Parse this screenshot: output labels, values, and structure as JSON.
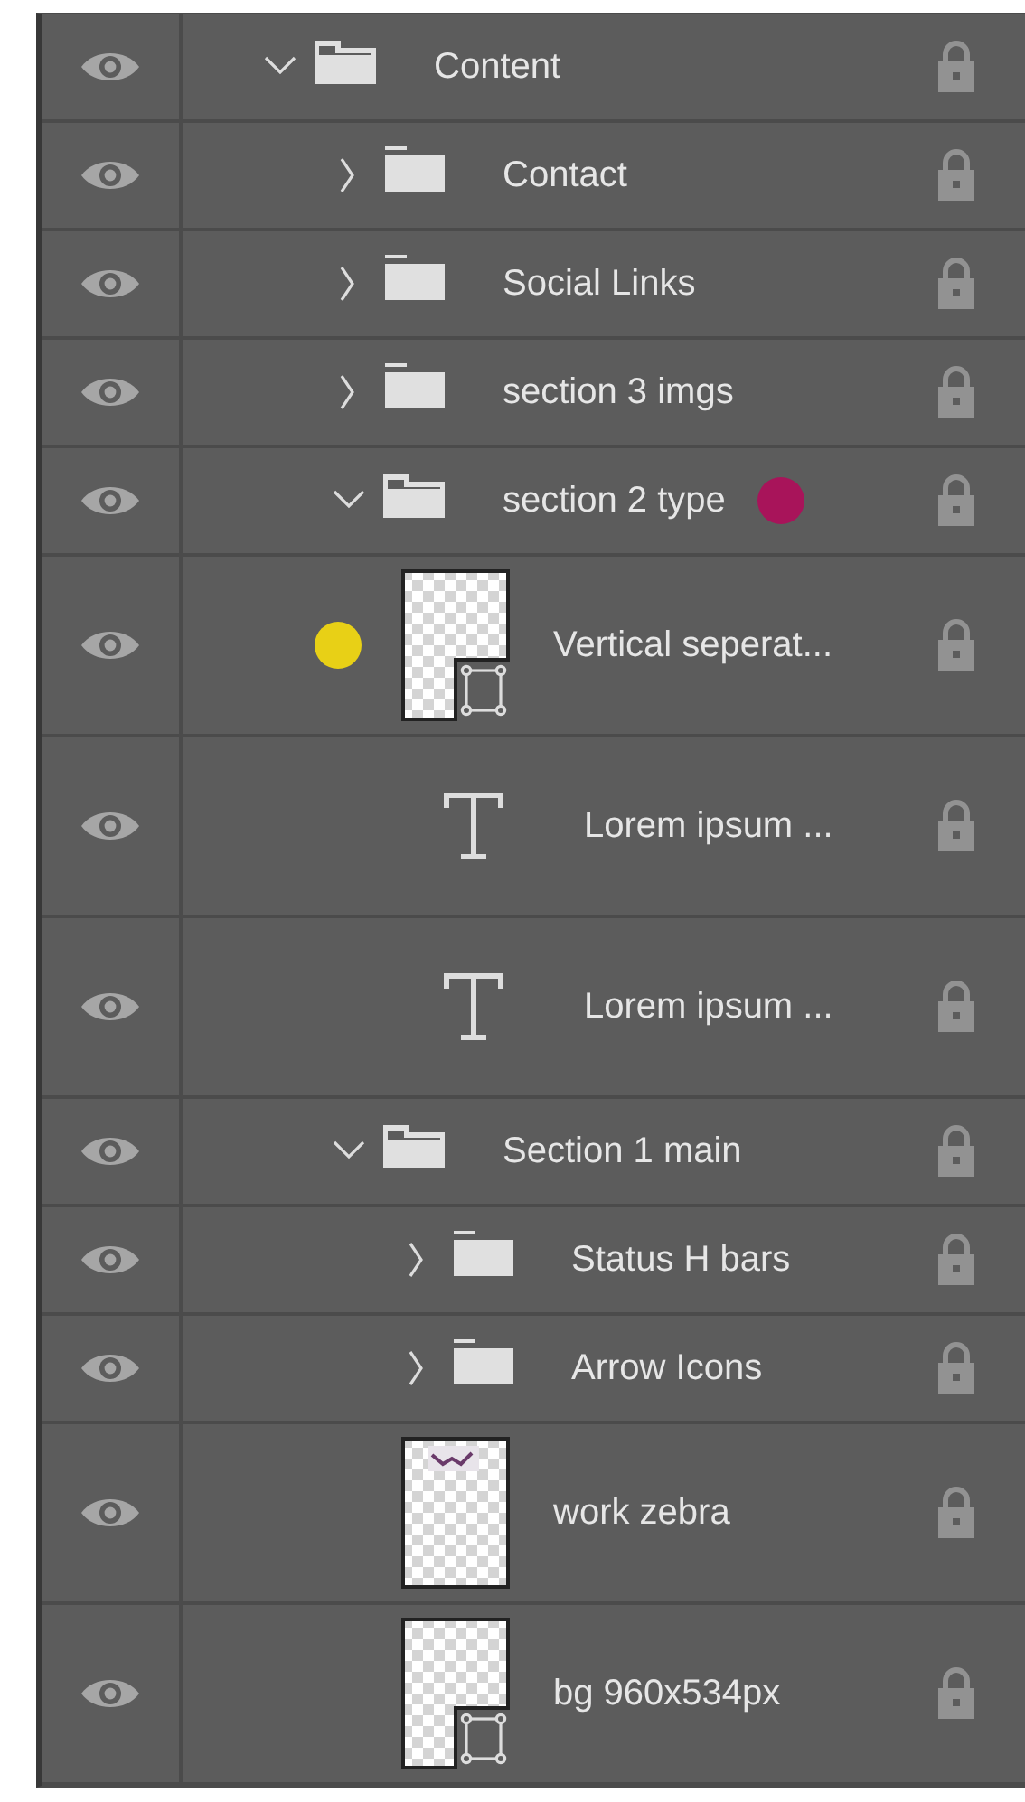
{
  "layers": [
    {
      "kind": "group",
      "name": "Content",
      "visible": true,
      "expanded": true,
      "children": [
        {
          "kind": "group",
          "name": "Contact",
          "visible": true,
          "expanded": false
        },
        {
          "kind": "group",
          "name": "Social Links",
          "visible": true,
          "expanded": false
        },
        {
          "kind": "group",
          "name": "section 3 imgs",
          "visible": true,
          "expanded": false
        },
        {
          "kind": "group",
          "name": "section 2 type",
          "visible": true,
          "expanded": true,
          "color": "#a8145a",
          "children": [
            {
              "kind": "shape",
              "name": "Vertical seperat...",
              "visible": true,
              "color": "#e8d016"
            },
            {
              "kind": "text",
              "name": "Lorem ipsum ...",
              "visible": true
            },
            {
              "kind": "text",
              "name": "Lorem ipsum ...",
              "visible": true
            }
          ]
        },
        {
          "kind": "group",
          "name": "Section 1 main",
          "visible": true,
          "expanded": true,
          "children": [
            {
              "kind": "group",
              "name": "Status H bars",
              "visible": true,
              "expanded": false
            },
            {
              "kind": "group",
              "name": "Arrow Icons",
              "visible": true,
              "expanded": false
            },
            {
              "kind": "pixel",
              "name": "work zebra",
              "visible": true
            },
            {
              "kind": "shape",
              "name": "bg 960x534px",
              "visible": true
            }
          ]
        }
      ]
    }
  ]
}
